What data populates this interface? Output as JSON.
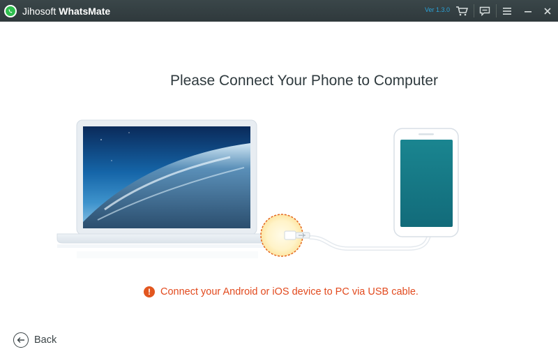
{
  "window": {
    "title_part1": "Jihosoft",
    "title_part2": "WhatsMate",
    "version": "Ver 1.3.0",
    "controls": {
      "cart": "cart-icon",
      "feedback": "chat-icon",
      "menu": "menu-icon",
      "minimize": "minimize-icon",
      "close": "close-icon"
    }
  },
  "main": {
    "heading": "Please Connect Your Phone to Computer",
    "status_message": "Connect your Android or iOS device to PC via USB cable.",
    "status_icon": "!",
    "back_label": "Back"
  },
  "colors": {
    "titlebar": "#33403f",
    "accent_green": "#2fbf4f",
    "warning": "#e24a1e",
    "phone_screen": "#177a86"
  }
}
